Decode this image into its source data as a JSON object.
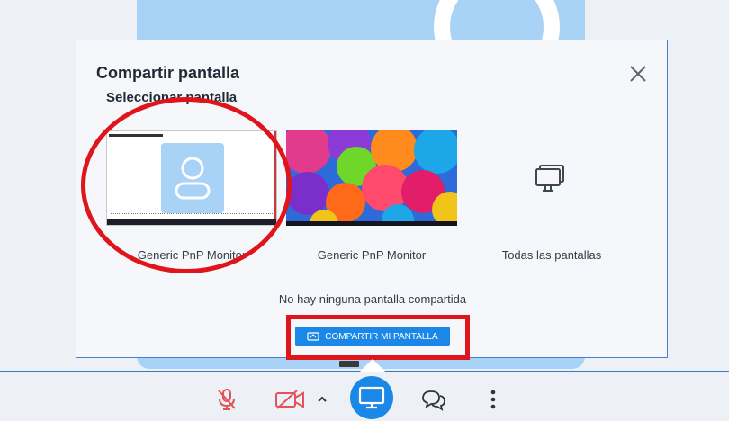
{
  "dialog": {
    "title": "Compartir pantalla",
    "section_title": "Seleccionar pantalla",
    "options": [
      {
        "label": "Generic PnP Monitor",
        "preview": "screen-preview"
      },
      {
        "label": "Generic PnP Monitor",
        "preview": "umbrellas-wallpaper"
      },
      {
        "label": "Todas las pantallas",
        "preview": "all-screens-icon"
      }
    ],
    "status": "No hay ninguna pantalla compartida",
    "share_button": "COMPARTIR MI PANTALLA"
  },
  "toolbar": {
    "buttons": [
      {
        "name": "mic-muted-icon",
        "state": "off"
      },
      {
        "name": "camera-off-icon",
        "state": "off"
      },
      {
        "name": "chevron-up-icon"
      },
      {
        "name": "screen-share-icon",
        "state": "active"
      },
      {
        "name": "chat-icon"
      },
      {
        "name": "more-icon"
      }
    ]
  },
  "colors": {
    "accent": "#1b87e6",
    "annotation": "#e0141b",
    "muted_red": "#e0545a",
    "tile": "#a8d2f6"
  }
}
